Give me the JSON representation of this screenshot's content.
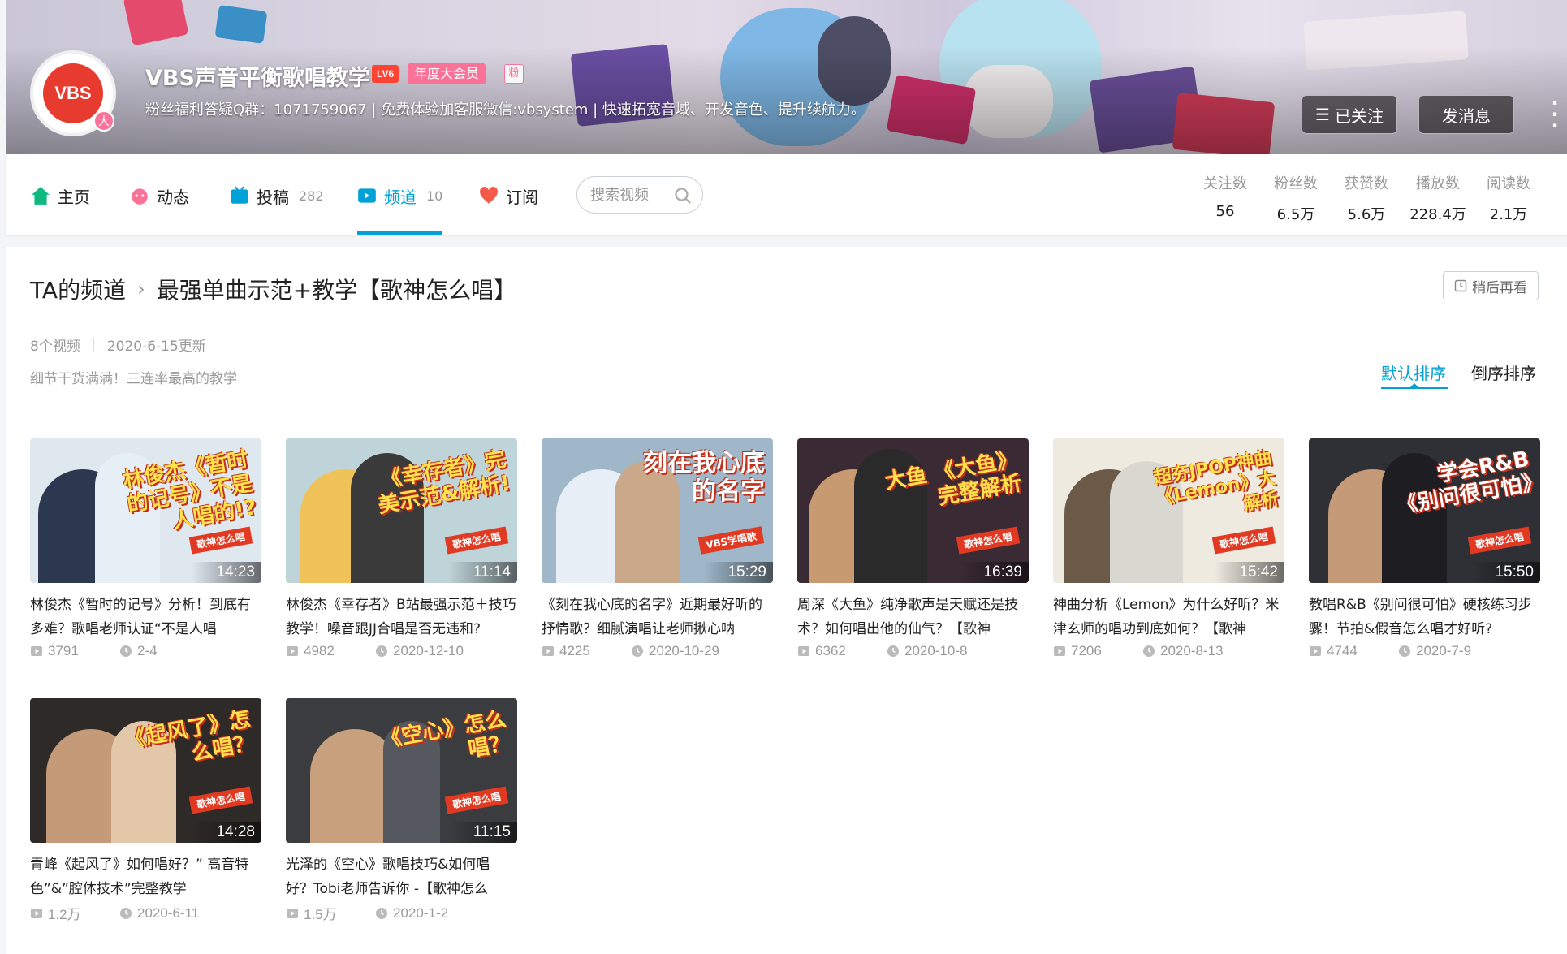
{
  "profile": {
    "name": "VBS声音平衡歌唱教学",
    "level": "LV6",
    "vip": "年度大会员",
    "fans_medal": "粉",
    "avatar_text": "VBS",
    "avatar_badge": "大",
    "signature": "粉丝福利答疑Q群：1071759067 | 免费体验加客服微信:vbsystem | 快速拓宽音域、开发音色、提升续航力。",
    "follow_label": "已关注",
    "message_label": "发消息"
  },
  "nav": {
    "home": "主页",
    "dynamic": "动态",
    "uploads": "投稿",
    "uploads_count": "282",
    "channel": "频道",
    "channel_count": "10",
    "subscribe": "订阅",
    "search_placeholder": "搜索视频"
  },
  "stats": [
    {
      "label": "关注数",
      "value": "56"
    },
    {
      "label": "粉丝数",
      "value": "6.5万"
    },
    {
      "label": "获赞数",
      "value": "5.6万"
    },
    {
      "label": "播放数",
      "value": "228.4万"
    },
    {
      "label": "阅读数",
      "value": "2.1万"
    }
  ],
  "channel": {
    "crumb_root": "TA的频道",
    "crumb_sep": "›",
    "title": "最强单曲示范+教学【歌神怎么唱】",
    "watch_later": "稍后再看",
    "video_count": "8个视频",
    "updated": "2020-6-15更新",
    "description": "细节干货满满！三连率最高的教学",
    "sort_default": "默认排序",
    "sort_reverse": "倒序排序"
  },
  "videos": [
    {
      "thumb_title": "林俊杰《暂时的记号》不是人唱的!?",
      "thumb_tag": "歌神怎么唱",
      "duration": "14:23",
      "title": "林俊杰《暂时的记号》分析！到底有多难？歌唱老师认证“不是人唱",
      "plays": "3791",
      "date": "2-4",
      "bg": "#dfe7ef",
      "person": "#2b3850"
    },
    {
      "thumb_title": "《幸存者》完美示范&解析!",
      "thumb_tag": "歌神怎么唱",
      "duration": "11:14",
      "title": "林俊杰《幸存者》B站最强示范＋技巧教学！嗓音跟JJ合唱是否无违和?",
      "plays": "4982",
      "date": "2020-12-10",
      "bg": "#bfd4d8",
      "person": "#3a3a3a"
    },
    {
      "thumb_title": "刻在我心底的名字",
      "thumb_tag": "VBS学唱歌",
      "duration": "15:29",
      "title": "《刻在我心底的名字》近期最好听的抒情歌？细腻演唱让老师揪心呐",
      "plays": "4225",
      "date": "2020-10-29",
      "bg": "#9fb7c9",
      "person": "#e8eef5"
    },
    {
      "thumb_title": "大鱼 《大鱼》完整解析",
      "thumb_tag": "歌神怎么唱",
      "duration": "16:39",
      "title": "周深《大鱼》纯净歌声是天赋还是技术？如何唱出他的仙气？【歌神",
      "plays": "6362",
      "date": "2020-10-8",
      "bg": "#3a2a33",
      "person": "#2a2a2a"
    },
    {
      "thumb_title": "超夯JPOP神曲 《Lemon》大解析",
      "thumb_tag": "歌神怎么唱",
      "duration": "15:42",
      "title": "神曲分析《Lemon》为什么好听？米津玄师的唱功到底如何？【歌神",
      "plays": "7206",
      "date": "2020-8-13",
      "bg": "#eeeae0",
      "person": "#d8d8d0"
    },
    {
      "thumb_title": "学会R&B 《别问很可怕》",
      "thumb_tag": "歌神怎么唱",
      "duration": "15:50",
      "title": "教唱R&B《别问很可怕》硬核练习步骤！节拍&假音怎么唱才好听?",
      "plays": "4744",
      "date": "2020-7-9",
      "bg": "#2f3035",
      "person": "#1e1e22"
    },
    {
      "thumb_title": "《起风了》怎么唱？",
      "thumb_tag": "歌神怎么唱",
      "duration": "14:28",
      "title": "青峰《起风了》如何唱好？” 高音特色”&”腔体技术”完整教学",
      "plays": "1.2万",
      "date": "2020-6-11",
      "bg": "#2e2a28",
      "person": "#1f1f1f"
    },
    {
      "thumb_title": "《空心》怎么唱？",
      "thumb_tag": "歌神怎么唱",
      "duration": "11:15",
      "title": "光泽的《空心》歌唱技巧&如何唱好？Tobi老师告诉你 -【歌神怎么",
      "plays": "1.5万",
      "date": "2020-1-2",
      "bg": "#3b3c40",
      "person": "#55595f"
    }
  ],
  "colors": {
    "accent": "#00a1d6",
    "pink": "#fb7299",
    "vip": "#fb7299"
  }
}
